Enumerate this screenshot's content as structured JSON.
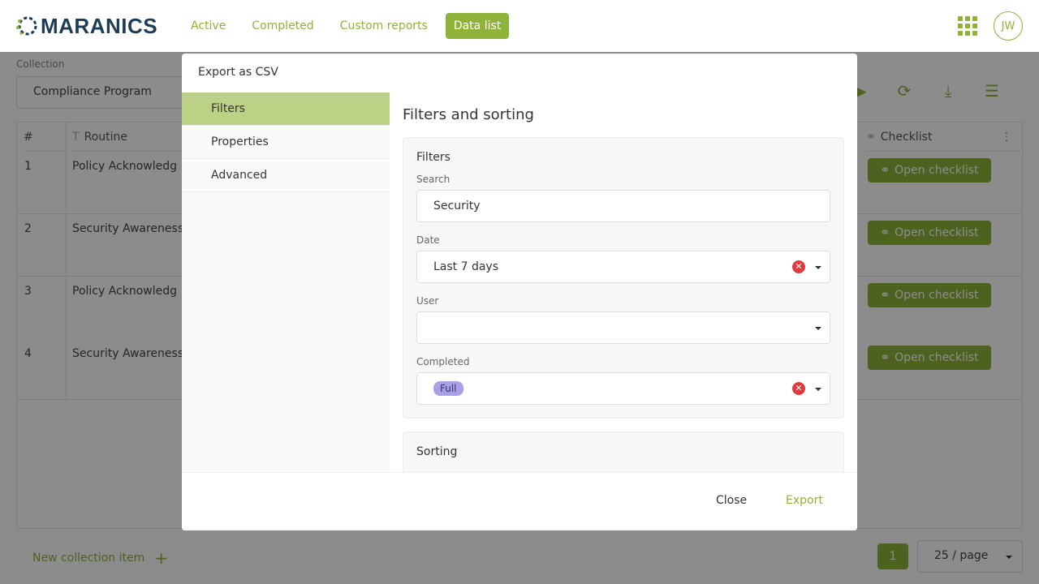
{
  "brand": {
    "name": "MARANICS"
  },
  "nav": {
    "items": [
      {
        "label": "Active"
      },
      {
        "label": "Completed"
      },
      {
        "label": "Custom reports"
      },
      {
        "label": "Data list"
      }
    ]
  },
  "user": {
    "initials": "JW"
  },
  "page": {
    "collection_label": "Collection",
    "collection_value": "Compliance Program",
    "table": {
      "headers": {
        "num": "#",
        "routine": "Routine",
        "checklist": "Checklist"
      },
      "rows": [
        {
          "num": "1",
          "routine": "Policy Acknowledg",
          "action": "Open checklist"
        },
        {
          "num": "2",
          "routine": "Security Awareness",
          "action": "Open checklist"
        },
        {
          "num": "3",
          "routine": "Policy Acknowledg",
          "action": "Open checklist"
        },
        {
          "num": "4",
          "routine": "Security Awareness",
          "action": "Open checklist"
        }
      ]
    },
    "new_item_label": "New collection item",
    "current_page": "1",
    "page_size": "25 / page"
  },
  "modal": {
    "title": "Export as CSV",
    "tabs": [
      {
        "label": "Filters"
      },
      {
        "label": "Properties"
      },
      {
        "label": "Advanced"
      }
    ],
    "section_title": "Filters and sorting",
    "filters": {
      "title": "Filters",
      "search_label": "Search",
      "search_value": "Security",
      "date_label": "Date",
      "date_value": "Last 7 days",
      "user_label": "User",
      "user_value": "",
      "completed_label": "Completed",
      "completed_chip": "Full"
    },
    "sorting_title": "Sorting",
    "close_label": "Close",
    "export_label": "Export"
  },
  "colors": {
    "accent": "#8fb339",
    "active_tab": "#bcd185",
    "chip": "#a9a1e6",
    "clear": "#e03b3b"
  }
}
